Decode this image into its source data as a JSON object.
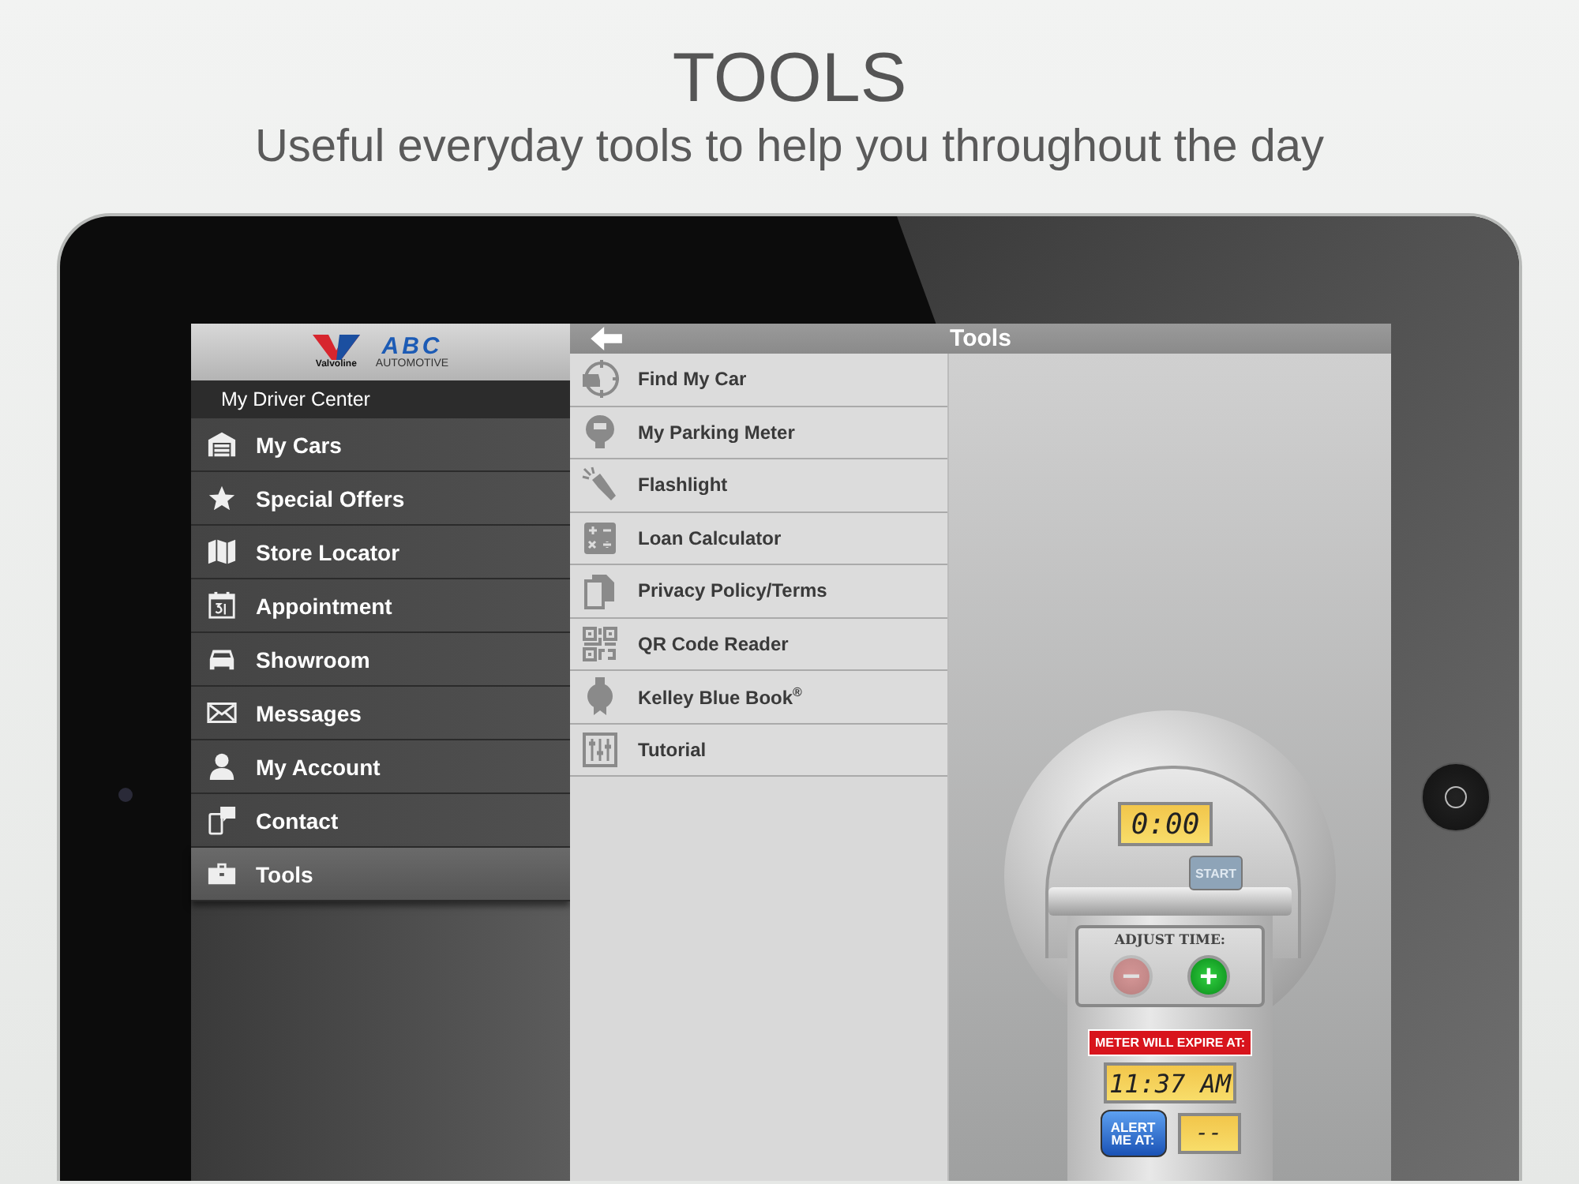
{
  "headline": {
    "title": "TOOLS",
    "subtitle": "Useful everyday tools to help you throughout the day"
  },
  "sidebar": {
    "logo": {
      "brand": "Valvoline",
      "dealer_name": "ABC",
      "dealer_tagline": "AUTOMOTIVE"
    },
    "section_title": "My Driver Center",
    "items": [
      {
        "label": "My Cars",
        "selected": false
      },
      {
        "label": "Special Offers",
        "selected": false
      },
      {
        "label": "Store Locator",
        "selected": false
      },
      {
        "label": "Appointment",
        "selected": false
      },
      {
        "label": "Showroom",
        "selected": false
      },
      {
        "label": "Messages",
        "selected": false
      },
      {
        "label": "My Account",
        "selected": false
      },
      {
        "label": "Contact",
        "selected": false
      },
      {
        "label": "Tools",
        "selected": true
      }
    ]
  },
  "header": {
    "title": "Tools"
  },
  "tools": [
    {
      "label": "Find My Car"
    },
    {
      "label": "My Parking Meter"
    },
    {
      "label": "Flashlight"
    },
    {
      "label": "Loan Calculator"
    },
    {
      "label": "Privacy Policy/Terms"
    },
    {
      "label": "QR Code Reader"
    },
    {
      "label": "Kelley Blue Book$^{®}$"
    },
    {
      "label": "Tutorial"
    }
  ],
  "meter": {
    "time_remaining": "0:00",
    "start_label": "START",
    "adjust_label": "ADJUST TIME:",
    "decrease": {
      "label": "−",
      "disabled": true
    },
    "increase": {
      "label": "+",
      "disabled": false
    },
    "expire_label": "METER WILL EXPIRE AT:",
    "expire_time": "11:37 AM",
    "alert_label": "ALERT ME AT:",
    "alert_time": "--"
  }
}
